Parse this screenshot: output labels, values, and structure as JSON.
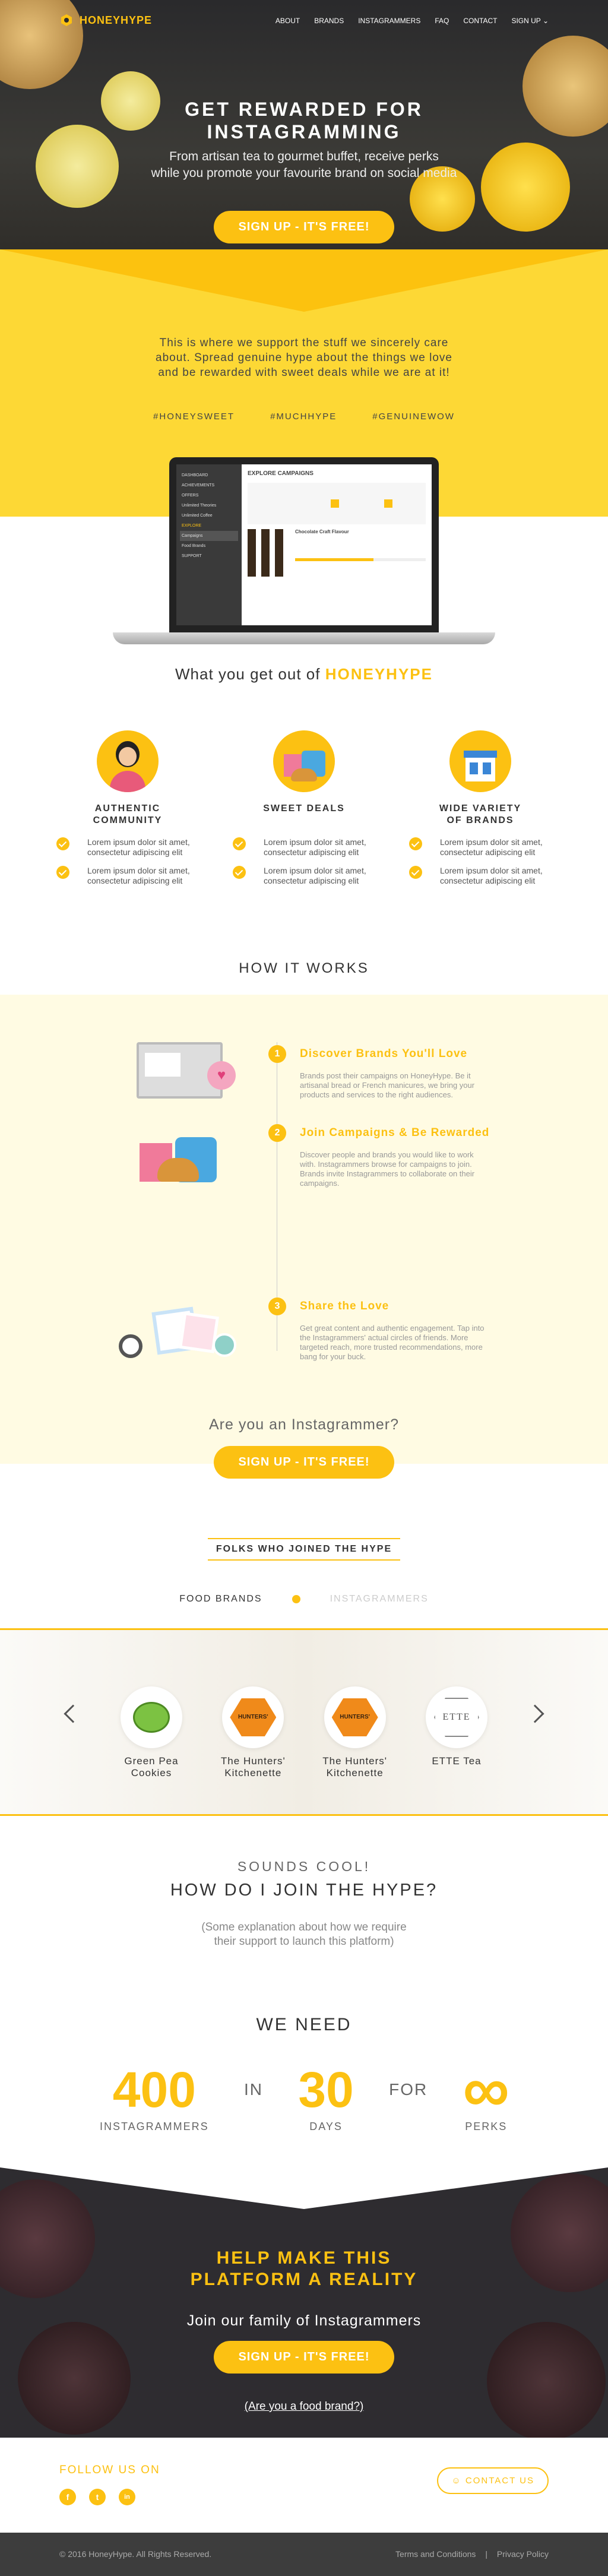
{
  "brand": {
    "name": "HONEYHYPE",
    "accent": "#fcc112"
  },
  "nav": {
    "items": [
      "ABOUT",
      "BRANDS",
      "INSTAGRAMMERS",
      "FAQ",
      "CONTACT",
      "SIGN UP"
    ]
  },
  "hero": {
    "title_line1": "GET REWARDED FOR",
    "title_line2": "INSTAGRAMMING",
    "subtitle_line1": "From artisan tea to gourmet buffet,  receive perks",
    "subtitle_line2": "while you promote your favourite brand on social media",
    "cta": "SIGN UP - IT'S FREE!"
  },
  "intro": {
    "text": "This is where we support the stuff we sincerely care about. Spread genuine hype about the things we love and be rewarded with sweet deals while we are at it!",
    "tags": [
      "#HONEYSWEET",
      "#MUCHHYPE",
      "#GENUINEWOW"
    ]
  },
  "laptop": {
    "sidebar": [
      "DASHBOARD",
      "ACHIEVEMENTS",
      "OFFERS",
      "Unlimited Theories",
      "Unlimited Coffee",
      "EXPLORE",
      "Campaigns",
      "Food Brands",
      "SUPPORT"
    ],
    "heading": "EXPLORE CAMPAIGNS",
    "product": "Chocolate Craft Flavour"
  },
  "benefits": {
    "title_prefix": "What you get out of ",
    "title_brand": "HONEYHYPE",
    "columns": [
      {
        "title_line1": "AUTHENTIC",
        "title_line2": "COMMUNITY",
        "points": [
          "Lorem ipsum dolor sit amet, consectetur adipiscing elit",
          "Lorem ipsum dolor sit amet, consectetur adipiscing elit"
        ]
      },
      {
        "title_line1": "SWEET DEALS",
        "title_line2": "",
        "points": [
          "Lorem ipsum dolor sit amet, consectetur adipiscing elit",
          "Lorem ipsum dolor sit amet, consectetur adipiscing elit"
        ]
      },
      {
        "title_line1": "WIDE VARIETY",
        "title_line2": "OF BRANDS",
        "points": [
          "Lorem ipsum dolor sit amet, consectetur adipiscing elit",
          "Lorem ipsum dolor sit amet, consectetur adipiscing elit"
        ]
      }
    ]
  },
  "how": {
    "title": "HOW IT WORKS",
    "steps": [
      {
        "num": "1",
        "title": "Discover Brands You'll Love",
        "text": "Brands post their campaigns on HoneyHype. Be it artisanal bread or French manicures, we bring your products and services to the right audiences."
      },
      {
        "num": "2",
        "title": "Join Campaigns & Be Rewarded",
        "text": "Discover people and brands you would like to work with. Instagrammers browse for campaigns to join. Brands invite Instagrammers to collaborate on their campaigns."
      },
      {
        "num": "3",
        "title": "Share the Love",
        "text": "Get great content and authentic engagement. Tap into the Instagrammers' actual circles of friends. More targeted reach, more trusted recommendations, more bang for your buck."
      }
    ],
    "question": "Are you an Instagrammer?",
    "cta": "SIGN UP - IT'S FREE!"
  },
  "folks": {
    "title": "FOLKS WHO JOINED THE HYPE",
    "tabs": [
      "FOOD BRANDS",
      "INSTAGRAMMERS"
    ],
    "brands": [
      {
        "name_line1": "Green Pea",
        "name_line2": "Cookies"
      },
      {
        "name_line1": "The Hunters'",
        "name_line2": "Kitchenette",
        "logo_text": "HUNTERS'"
      },
      {
        "name_line1": "The Hunters'",
        "name_line2": "Kitchenette",
        "logo_text": "HUNTERS'"
      },
      {
        "name_line1": "ETTE Tea",
        "name_line2": "",
        "logo_text": "ETTE"
      }
    ]
  },
  "join": {
    "kicker": "SOUNDS COOL!",
    "title": "HOW DO I JOIN THE HYPE?",
    "sub_line1": "(Some explanation about how we require",
    "sub_line2": "their support to launch this platform)"
  },
  "needs": {
    "title": "WE NEED",
    "stats": [
      {
        "value": "400",
        "label": "INSTAGRAMMERS"
      },
      {
        "value": "30",
        "label": "DAYS"
      },
      {
        "value": "∞",
        "label": "PERKS"
      }
    ],
    "joiners": [
      "IN",
      "FOR"
    ]
  },
  "cta": {
    "title_line1": "HELP MAKE THIS",
    "title_line2": "PLATFORM A REALITY",
    "sub": "Join our family of Instagrammers",
    "button": "SIGN UP - IT'S FREE!",
    "link": "(Are you a food brand?)"
  },
  "footer": {
    "follow": "FOLLOW US ON",
    "social": [
      "f",
      "t",
      "in"
    ],
    "contact": "CONTACT US",
    "copyright": "© 2016 HoneyHype.  All Rights Reserved.",
    "legal": [
      "Terms and Conditions",
      "|",
      "Privacy Policy"
    ]
  }
}
